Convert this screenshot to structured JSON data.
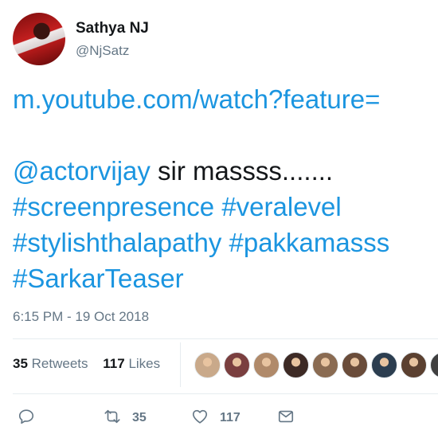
{
  "user": {
    "name": "Sathya NJ",
    "handle": "@NjSatz"
  },
  "tweet": {
    "link": "m.youtube.com/watch?feature=",
    "mention": "@actorvijay",
    "text_after_mention": " sir massss.......",
    "hashtags_line1": [
      "#screenpresence",
      "#veralevel"
    ],
    "hashtags_line2": [
      "#stylishthalapathy",
      "#pakkamasss"
    ],
    "hashtags_line3": [
      "#SarkarTeaser"
    ]
  },
  "timestamp": "6:15 PM - 19 Oct 2018",
  "stats": {
    "retweets_count": "35",
    "retweets_label": "Retweets",
    "likes_count": "117",
    "likes_label": "Likes"
  },
  "likers": [
    {
      "color": "#c9a98a"
    },
    {
      "color": "#7a3f3f"
    },
    {
      "color": "#b08a6a"
    },
    {
      "color": "#3d2a25"
    },
    {
      "color": "#8a6b52"
    },
    {
      "color": "#6a4c3a"
    },
    {
      "color": "#2c3e50"
    },
    {
      "color": "#5b4030"
    },
    {
      "color": "#404040"
    }
  ],
  "actions": {
    "reply": {
      "icon": "reply-icon"
    },
    "retweet": {
      "icon": "retweet-icon",
      "count": "35"
    },
    "like": {
      "icon": "heart-icon",
      "count": "117"
    },
    "dm": {
      "icon": "envelope-icon"
    }
  },
  "colors": {
    "link": "#1b95e0",
    "muted": "#657786",
    "text": "#14171a"
  }
}
